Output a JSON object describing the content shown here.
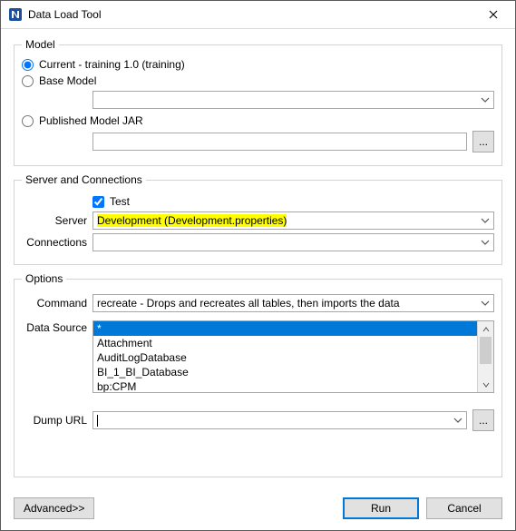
{
  "window": {
    "title": "Data Load Tool"
  },
  "model": {
    "legend": "Model",
    "current_label": "Current - training 1.0 (training)",
    "base_label": "Base Model",
    "base_value": "",
    "published_label": "Published Model JAR",
    "published_value": ""
  },
  "server_conn": {
    "legend": "Server and Connections",
    "test_label": "Test",
    "server_label": "Server",
    "server_value": "Development (Development.properties)",
    "connections_label": "Connections",
    "connections_value": ""
  },
  "options": {
    "legend": "Options",
    "command_label": "Command",
    "command_value": "recreate - Drops and recreates all tables, then imports the data",
    "datasource_label": "Data Source",
    "datasource_items": [
      "*",
      "Attachment",
      "AuditLogDatabase",
      "BI_1_BI_Database",
      "bp:CPM"
    ],
    "dumpurl_label": "Dump URL",
    "dumpurl_value": ""
  },
  "footer": {
    "advanced_label": "Advanced>>",
    "run_label": "Run",
    "cancel_label": "Cancel"
  }
}
